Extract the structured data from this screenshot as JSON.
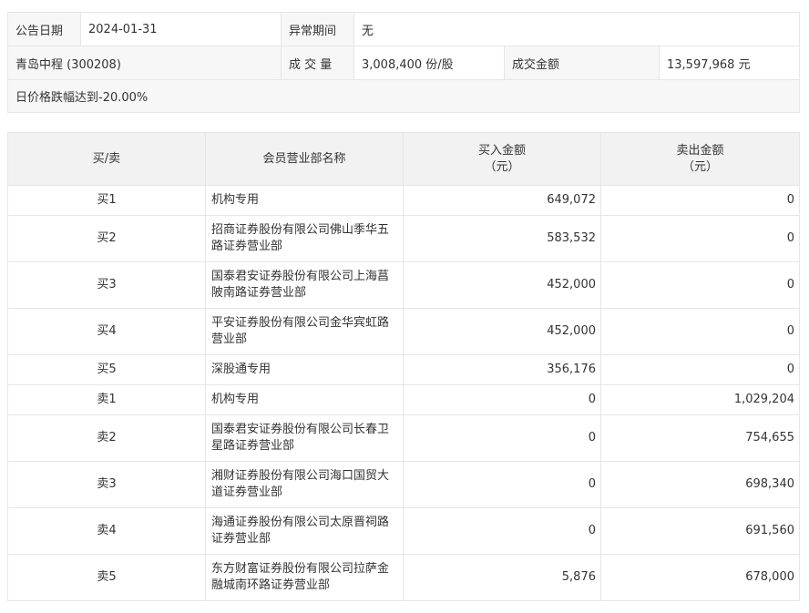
{
  "info": {
    "announce_date_label": "公告日期",
    "announce_date": "2024-01-31",
    "abnormal_period_label": "异常期间",
    "abnormal_period": "无",
    "stock_name": "青岛中程 (300208)",
    "volume_label": "成 交 量",
    "volume": "3,008,400 份/股",
    "amount_label": "成交金额",
    "amount": "13,597,968 元",
    "reason": "日价格跌幅达到-20.00%"
  },
  "trade_table": {
    "headers": {
      "type": "买/卖",
      "member": "会员营业部名称",
      "buy_title": "买入金额",
      "buy_unit": "（元）",
      "sell_title": "卖出金额",
      "sell_unit": "（元）"
    },
    "rows": [
      {
        "type": "买1",
        "name": "机构专用",
        "buy": "649,072",
        "sell": "0"
      },
      {
        "type": "买2",
        "name": "招商证券股份有限公司佛山季华五路证券营业部",
        "buy": "583,532",
        "sell": "0"
      },
      {
        "type": "买3",
        "name": "国泰君安证券股份有限公司上海菖陂南路证券营业部",
        "buy": "452,000",
        "sell": "0"
      },
      {
        "type": "买4",
        "name": "平安证券股份有限公司金华宾虹路营业部",
        "buy": "452,000",
        "sell": "0"
      },
      {
        "type": "买5",
        "name": "深股通专用",
        "buy": "356,176",
        "sell": "0"
      },
      {
        "type": "卖1",
        "name": "机构专用",
        "buy": "0",
        "sell": "1,029,204"
      },
      {
        "type": "卖2",
        "name": "国泰君安证券股份有限公司长春卫星路证券营业部",
        "buy": "0",
        "sell": "754,655"
      },
      {
        "type": "卖3",
        "name": "湘财证券股份有限公司海口国贸大道证券营业部",
        "buy": "0",
        "sell": "698,340"
      },
      {
        "type": "卖4",
        "name": "海通证券股份有限公司太原晋祠路证券营业部",
        "buy": "0",
        "sell": "691,560"
      },
      {
        "type": "卖5",
        "name": "东方财富证券股份有限公司拉萨金融城南环路证券营业部",
        "buy": "5,876",
        "sell": "678,000"
      }
    ]
  }
}
